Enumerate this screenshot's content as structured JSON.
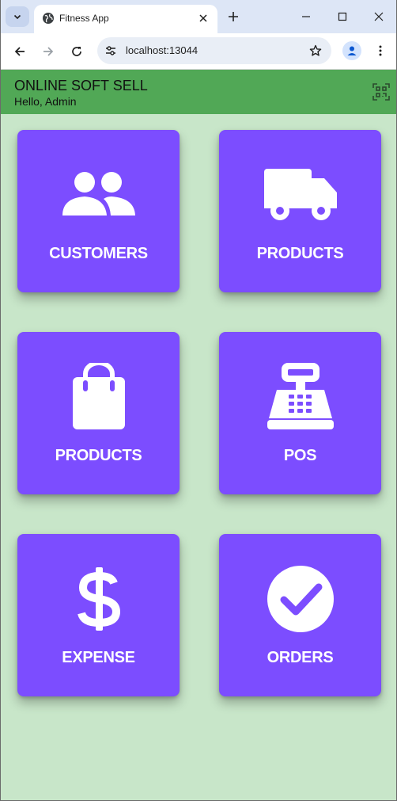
{
  "browser": {
    "tab_title": "Fitness App",
    "url": "localhost:13044"
  },
  "header": {
    "title": "ONLINE SOFT SELL",
    "greeting": "Hello, Admin"
  },
  "tiles": [
    {
      "label": "CUSTOMERS",
      "icon": "people-icon"
    },
    {
      "label": "PRODUCTS",
      "icon": "truck-icon"
    },
    {
      "label": "PRODUCTS",
      "icon": "shopping-bag-icon"
    },
    {
      "label": "POS",
      "icon": "cash-register-icon"
    },
    {
      "label": "EXPENSE",
      "icon": "dollar-icon"
    },
    {
      "label": "ORDERS",
      "icon": "check-circle-icon"
    }
  ],
  "colors": {
    "app_bar": "#51a856",
    "background": "#c8e6c9",
    "tile": "#7c4dff",
    "tile_text": "#ffffff"
  }
}
